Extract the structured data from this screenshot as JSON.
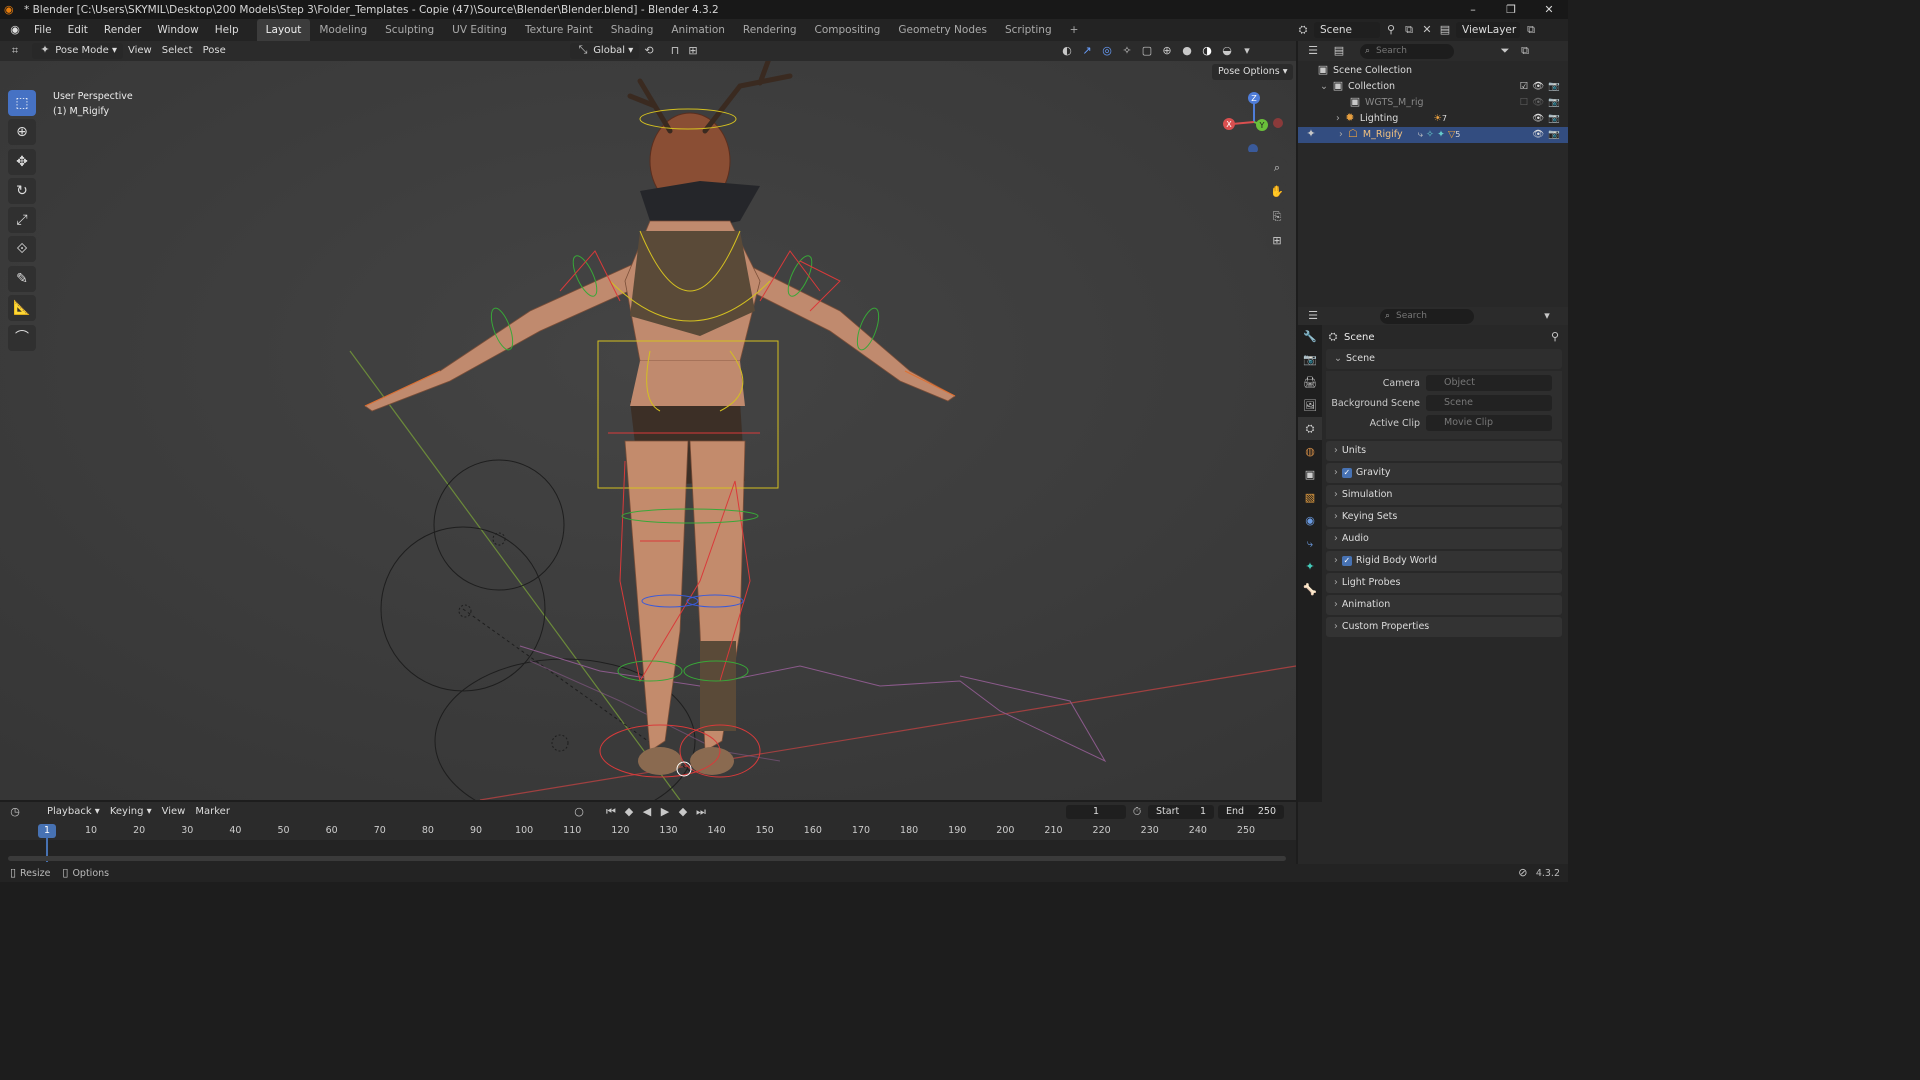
{
  "titlebar": {
    "title": "* Blender [C:\\Users\\SKYMIL\\Desktop\\200 Models\\Step 3\\Folder_Templates - Copie (47)\\Source\\Blender\\Blender.blend] - Blender 4.3.2",
    "minimize": "–",
    "maximize": "❐",
    "close": "✕"
  },
  "menu": [
    "File",
    "Edit",
    "Render",
    "Window",
    "Help"
  ],
  "workspaces": [
    "Layout",
    "Modeling",
    "Sculpting",
    "UV Editing",
    "Texture Paint",
    "Shading",
    "Animation",
    "Rendering",
    "Compositing",
    "Geometry Nodes",
    "Scripting"
  ],
  "active_workspace": "Layout",
  "scene_selector": {
    "label": "Scene",
    "view_layer": "ViewLayer"
  },
  "viewport_header": {
    "mode": "Pose Mode",
    "menus": [
      "View",
      "Select",
      "Pose"
    ],
    "transform_orientation": "Global",
    "pose_options": "Pose Options"
  },
  "viewport": {
    "perspective": "User Perspective",
    "object": "(1) M_Rigify",
    "gizmo": {
      "x": "X",
      "y": "Y",
      "z": "Z"
    }
  },
  "outliner": {
    "search_placeholder": "Search",
    "root": "Scene Collection",
    "items": [
      {
        "label": "Collection"
      },
      {
        "label": "WGTS_M_rig"
      },
      {
        "label": "Lighting",
        "badge": "7"
      },
      {
        "label": "M_Rigify",
        "badge": "5"
      }
    ]
  },
  "properties": {
    "search_placeholder": "Search",
    "context": "Scene",
    "scene_panel": "Scene",
    "fields": [
      {
        "label": "Camera",
        "value": "Object"
      },
      {
        "label": "Background Scene",
        "value": "Scene"
      },
      {
        "label": "Active Clip",
        "value": "Movie Clip"
      }
    ],
    "panels": [
      {
        "label": "Units",
        "checkbox": false
      },
      {
        "label": "Gravity",
        "checkbox": true
      },
      {
        "label": "Simulation",
        "checkbox": false
      },
      {
        "label": "Keying Sets",
        "checkbox": false
      },
      {
        "label": "Audio",
        "checkbox": false
      },
      {
        "label": "Rigid Body World",
        "checkbox": true
      },
      {
        "label": "Light Probes",
        "checkbox": false
      },
      {
        "label": "Animation",
        "checkbox": false
      },
      {
        "label": "Custom Properties",
        "checkbox": false
      }
    ]
  },
  "timeline": {
    "menus": [
      "Playback",
      "Keying",
      "View",
      "Marker"
    ],
    "current_frame": "1",
    "start_label": "Start",
    "start": "1",
    "end_label": "End",
    "end": "250",
    "ruler": [
      "1",
      "10",
      "20",
      "30",
      "40",
      "50",
      "60",
      "70",
      "80",
      "90",
      "100",
      "110",
      "120",
      "130",
      "140",
      "150",
      "160",
      "170",
      "180",
      "190",
      "200",
      "210",
      "220",
      "230",
      "240",
      "250"
    ]
  },
  "statusbar": {
    "resize": "Resize",
    "options": "Options",
    "version": "4.3.2"
  }
}
